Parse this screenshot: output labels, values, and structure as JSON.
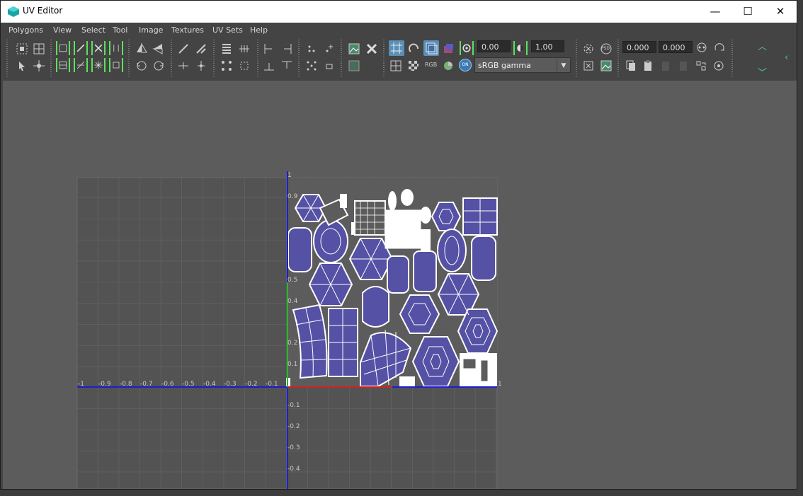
{
  "window": {
    "title": "UV Editor",
    "controls": {
      "minimize": "—",
      "maximize": "☐",
      "close": "✕"
    }
  },
  "menu": [
    "Polygons",
    "View",
    "Select",
    "Tool",
    "Image",
    "Textures",
    "UV Sets",
    "Help"
  ],
  "toolbar": {
    "exposure_value": "0.00",
    "gamma_value": "1.00",
    "color_space": "sRGB gamma",
    "rgb_label": "RGB",
    "on_label": "ON",
    "psd_label": "PSD",
    "u_coord": "0.000",
    "v_coord": "0.000"
  },
  "uv_grid": {
    "u_labels": [
      "-1",
      "-0.9",
      "-0.8",
      "-0.7",
      "-0.6",
      "-0.5",
      "-0.4",
      "-0.3",
      "-0.2",
      "-0.1",
      "1"
    ],
    "v_labels": [
      "1",
      "0.9",
      "0.5",
      "0.4",
      "0.2",
      "0.1",
      "-0.1",
      "-0.2",
      "-0.3",
      "-0.4"
    ]
  },
  "colors": {
    "uv_shell_fill": "#5551a5",
    "u_axis": "#d22020",
    "v_axis": "#20c020",
    "axis_line": "#1d1dd6",
    "background": "#5c5c5c"
  }
}
